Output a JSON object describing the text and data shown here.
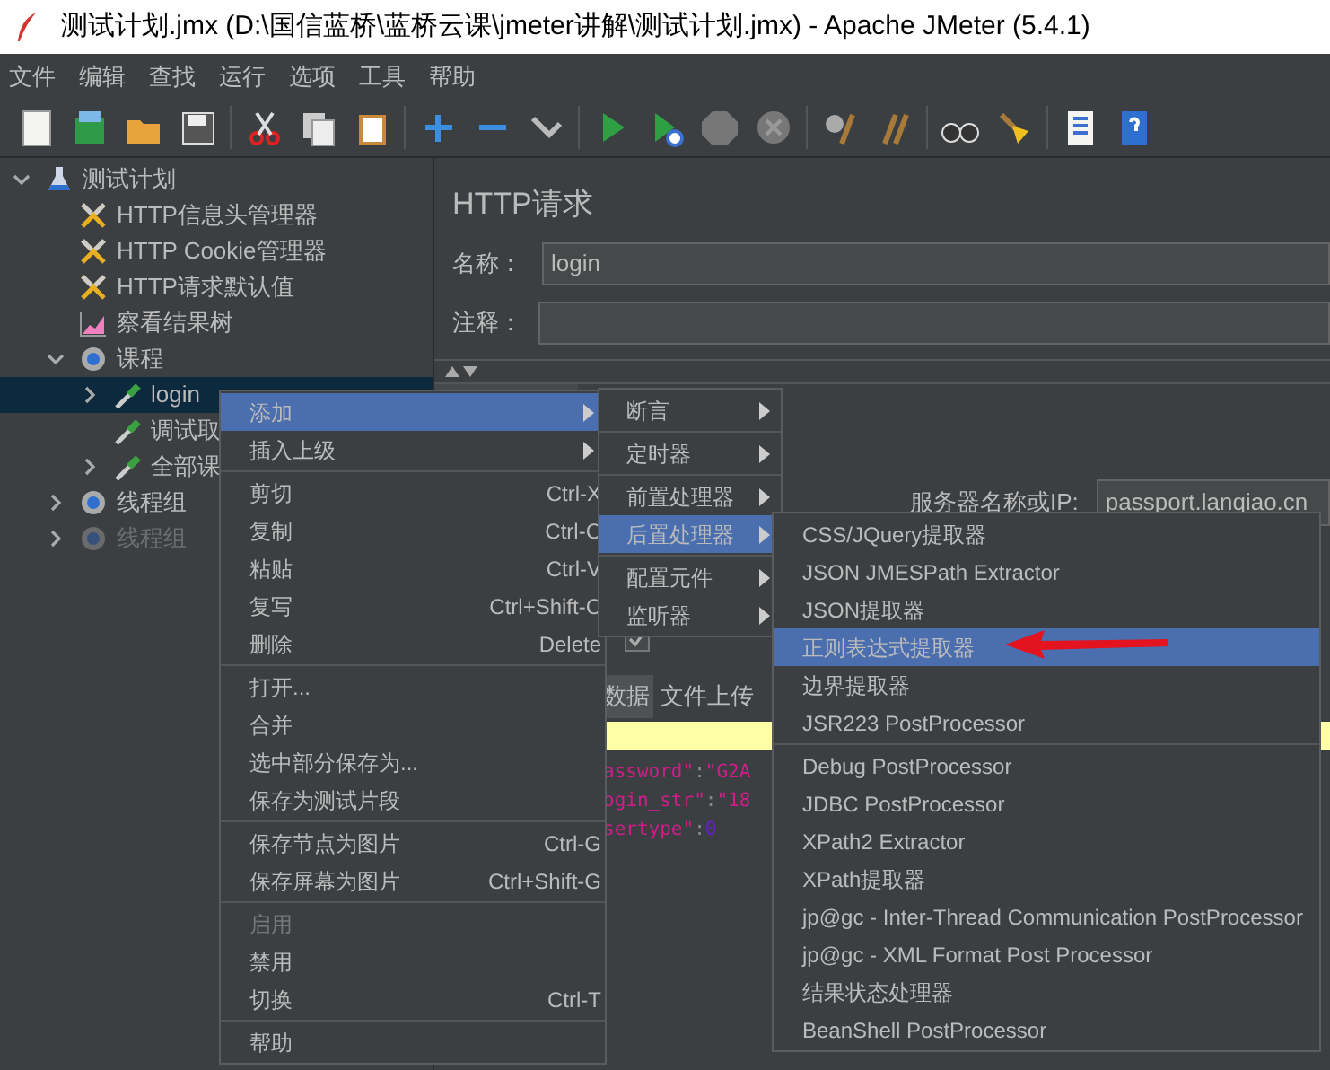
{
  "window": {
    "title": "测试计划.jmx (D:\\国信蓝桥\\蓝桥云课\\jmeter讲解\\测试计划.jmx) - Apache JMeter (5.4.1)"
  },
  "menubar": [
    "文件",
    "编辑",
    "查找",
    "运行",
    "选项",
    "工具",
    "帮助"
  ],
  "tree": [
    {
      "label": "测试计划",
      "kind": "plan",
      "expanded": true,
      "selected": false,
      "disabled": false,
      "children": [
        {
          "label": "HTTP信息头管理器",
          "kind": "config",
          "selected": false,
          "disabled": false
        },
        {
          "label": "HTTP Cookie管理器",
          "kind": "config",
          "selected": false,
          "disabled": false
        },
        {
          "label": "HTTP请求默认值",
          "kind": "config",
          "selected": false,
          "disabled": false
        },
        {
          "label": "察看结果树",
          "kind": "listener",
          "selected": false,
          "disabled": false
        },
        {
          "label": "课程",
          "kind": "threadgroup",
          "expanded": true,
          "selected": false,
          "disabled": false,
          "children": [
            {
              "label": "login",
              "kind": "sampler",
              "expanded": false,
              "selected": true,
              "disabled": false
            },
            {
              "label": "调试取",
              "kind": "sampler",
              "selected": false,
              "disabled": false
            },
            {
              "label": "全部课",
              "kind": "sampler",
              "expanded": false,
              "selected": false,
              "disabled": false
            }
          ]
        },
        {
          "label": "线程组",
          "kind": "threadgroup",
          "expanded": false,
          "selected": false,
          "disabled": false
        },
        {
          "label": "线程组",
          "kind": "threadgroup",
          "expanded": false,
          "selected": false,
          "disabled": true
        }
      ]
    }
  ],
  "panel": {
    "title": "HTTP请求",
    "name": {
      "label": "名称：",
      "value": "login"
    },
    "comment": {
      "label": "注释："
    },
    "server": {
      "label": "服务器名称或IP:",
      "value": "passport.lanqiao.cn"
    },
    "follow_redirects": {
      "checked": true
    },
    "body_tabs": [
      {
        "label": "数据",
        "selected": true
      },
      {
        "label": "文件上传",
        "selected": false
      }
    ],
    "code_lines": [
      [
        {
          "text": "assword\"",
          "kind": "key"
        },
        {
          "text": ":",
          "kind": "punct"
        },
        {
          "text": "\"G2A",
          "kind": "string"
        }
      ],
      [
        {
          "text": "ogin_str\"",
          "kind": "key"
        },
        {
          "text": ":",
          "kind": "punct"
        },
        {
          "text": "\"18",
          "kind": "string"
        }
      ],
      [
        {
          "text": "sertype\"",
          "kind": "key"
        },
        {
          "text": ":",
          "kind": "punct"
        },
        {
          "text": "0",
          "kind": "number"
        }
      ]
    ]
  },
  "context_menu": [
    {
      "kind": "item",
      "label": "添加",
      "submenu": true,
      "selected": true,
      "disabled": false
    },
    {
      "kind": "item",
      "label": "插入上级",
      "submenu": true,
      "selected": false,
      "disabled": false
    },
    {
      "kind": "separator"
    },
    {
      "kind": "item",
      "label": "剪切",
      "shortcut": "Ctrl-X",
      "selected": false,
      "disabled": false
    },
    {
      "kind": "item",
      "label": "复制",
      "shortcut": "Ctrl-C",
      "selected": false,
      "disabled": false
    },
    {
      "kind": "item",
      "label": "粘贴",
      "shortcut": "Ctrl-V",
      "selected": false,
      "disabled": false
    },
    {
      "kind": "item",
      "label": "复写",
      "shortcut": "Ctrl+Shift-C",
      "selected": false,
      "disabled": false
    },
    {
      "kind": "item",
      "label": "删除",
      "shortcut": "Delete",
      "selected": false,
      "disabled": false
    },
    {
      "kind": "separator"
    },
    {
      "kind": "item",
      "label": "打开...",
      "selected": false,
      "disabled": false
    },
    {
      "kind": "item",
      "label": "合并",
      "selected": false,
      "disabled": false
    },
    {
      "kind": "item",
      "label": "选中部分保存为...",
      "selected": false,
      "disabled": false
    },
    {
      "kind": "item",
      "label": "保存为测试片段",
      "selected": false,
      "disabled": false
    },
    {
      "kind": "separator"
    },
    {
      "kind": "item",
      "label": "保存节点为图片",
      "shortcut": "Ctrl-G",
      "selected": false,
      "disabled": false
    },
    {
      "kind": "item",
      "label": "保存屏幕为图片",
      "shortcut": "Ctrl+Shift-G",
      "selected": false,
      "disabled": false
    },
    {
      "kind": "separator"
    },
    {
      "kind": "item",
      "label": "启用",
      "selected": false,
      "disabled": true
    },
    {
      "kind": "item",
      "label": "禁用",
      "selected": false,
      "disabled": false
    },
    {
      "kind": "item",
      "label": "切换",
      "shortcut": "Ctrl-T",
      "selected": false,
      "disabled": false
    },
    {
      "kind": "separator"
    },
    {
      "kind": "item",
      "label": "帮助",
      "selected": false,
      "disabled": false
    }
  ],
  "add_submenu": [
    {
      "kind": "item",
      "label": "断言",
      "submenu": true,
      "selected": false
    },
    {
      "kind": "separator"
    },
    {
      "kind": "item",
      "label": "定时器",
      "submenu": true,
      "selected": false
    },
    {
      "kind": "separator"
    },
    {
      "kind": "item",
      "label": "前置处理器",
      "submenu": true,
      "selected": false
    },
    {
      "kind": "item",
      "label": "后置处理器",
      "submenu": true,
      "selected": true
    },
    {
      "kind": "separator"
    },
    {
      "kind": "item",
      "label": "配置元件",
      "submenu": true,
      "selected": false
    },
    {
      "kind": "item",
      "label": "监听器",
      "submenu": true,
      "selected": false
    }
  ],
  "postprocessor_submenu": [
    {
      "kind": "item",
      "label": "CSS/JQuery提取器",
      "selected": false
    },
    {
      "kind": "item",
      "label": "JSON JMESPath Extractor",
      "selected": false
    },
    {
      "kind": "item",
      "label": "JSON提取器",
      "selected": false
    },
    {
      "kind": "item",
      "label": "正则表达式提取器",
      "selected": true
    },
    {
      "kind": "item",
      "label": "边界提取器",
      "selected": false
    },
    {
      "kind": "item",
      "label": "JSR223 PostProcessor",
      "selected": false
    },
    {
      "kind": "separator"
    },
    {
      "kind": "item",
      "label": "Debug PostProcessor",
      "selected": false
    },
    {
      "kind": "item",
      "label": "JDBC PostProcessor",
      "selected": false
    },
    {
      "kind": "item",
      "label": "XPath2 Extractor",
      "selected": false
    },
    {
      "kind": "item",
      "label": "XPath提取器",
      "selected": false
    },
    {
      "kind": "item",
      "label": "jp@gc - Inter-Thread Communication PostProcessor",
      "selected": false
    },
    {
      "kind": "item",
      "label": "jp@gc - XML Format Post Processor",
      "selected": false
    },
    {
      "kind": "item",
      "label": "结果状态处理器",
      "selected": false
    },
    {
      "kind": "item",
      "label": "BeanShell PostProcessor",
      "selected": false
    }
  ]
}
